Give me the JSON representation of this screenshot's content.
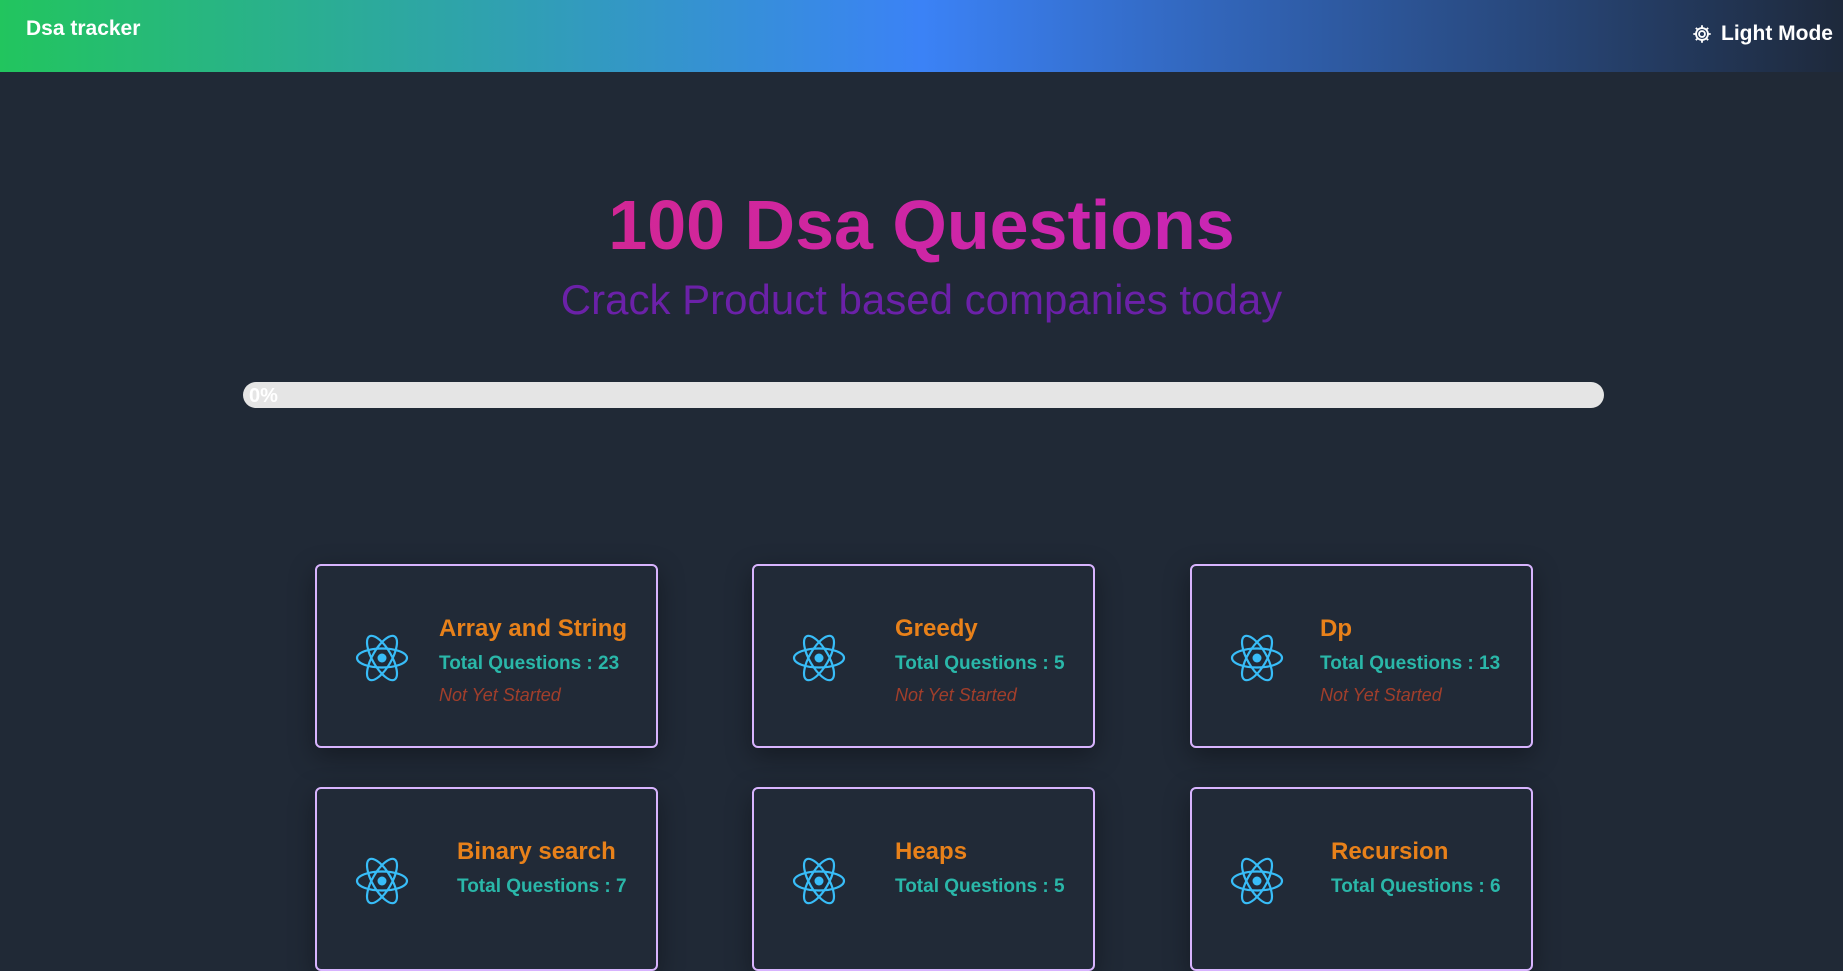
{
  "navbar": {
    "brand": "Dsa tracker",
    "theme_toggle_label": "Light Mode",
    "theme_toggle_icon": "gear-icon"
  },
  "hero": {
    "title": "100 Dsa Questions",
    "subtitle": "Crack Product based companies today"
  },
  "progress": {
    "percent": 0,
    "label": "0%"
  },
  "topics": [
    {
      "title": "Array and String",
      "count_text": "Total Questions : 23",
      "status": "Not Yet Started",
      "icon": "react-atom-icon"
    },
    {
      "title": "Greedy",
      "count_text": "Total Questions : 5",
      "status": "Not Yet Started",
      "icon": "react-atom-icon"
    },
    {
      "title": "Dp",
      "count_text": "Total Questions : 13",
      "status": "Not Yet Started",
      "icon": "react-atom-icon"
    },
    {
      "title": "Binary search",
      "count_text": "Total Questions : 7",
      "status": "",
      "icon": "react-atom-icon"
    },
    {
      "title": "Heaps",
      "count_text": "Total Questions : 5",
      "status": "",
      "icon": "react-atom-icon"
    },
    {
      "title": "Recursion",
      "count_text": "Total Questions : 6",
      "status": "",
      "icon": "react-atom-icon"
    }
  ],
  "colors": {
    "background": "#202936",
    "card_border": "#d8b4fe",
    "topic_title": "#e8811a",
    "topic_count": "#2ab7a9",
    "topic_status": "#a13e2b",
    "icon": "#38bdf8"
  }
}
